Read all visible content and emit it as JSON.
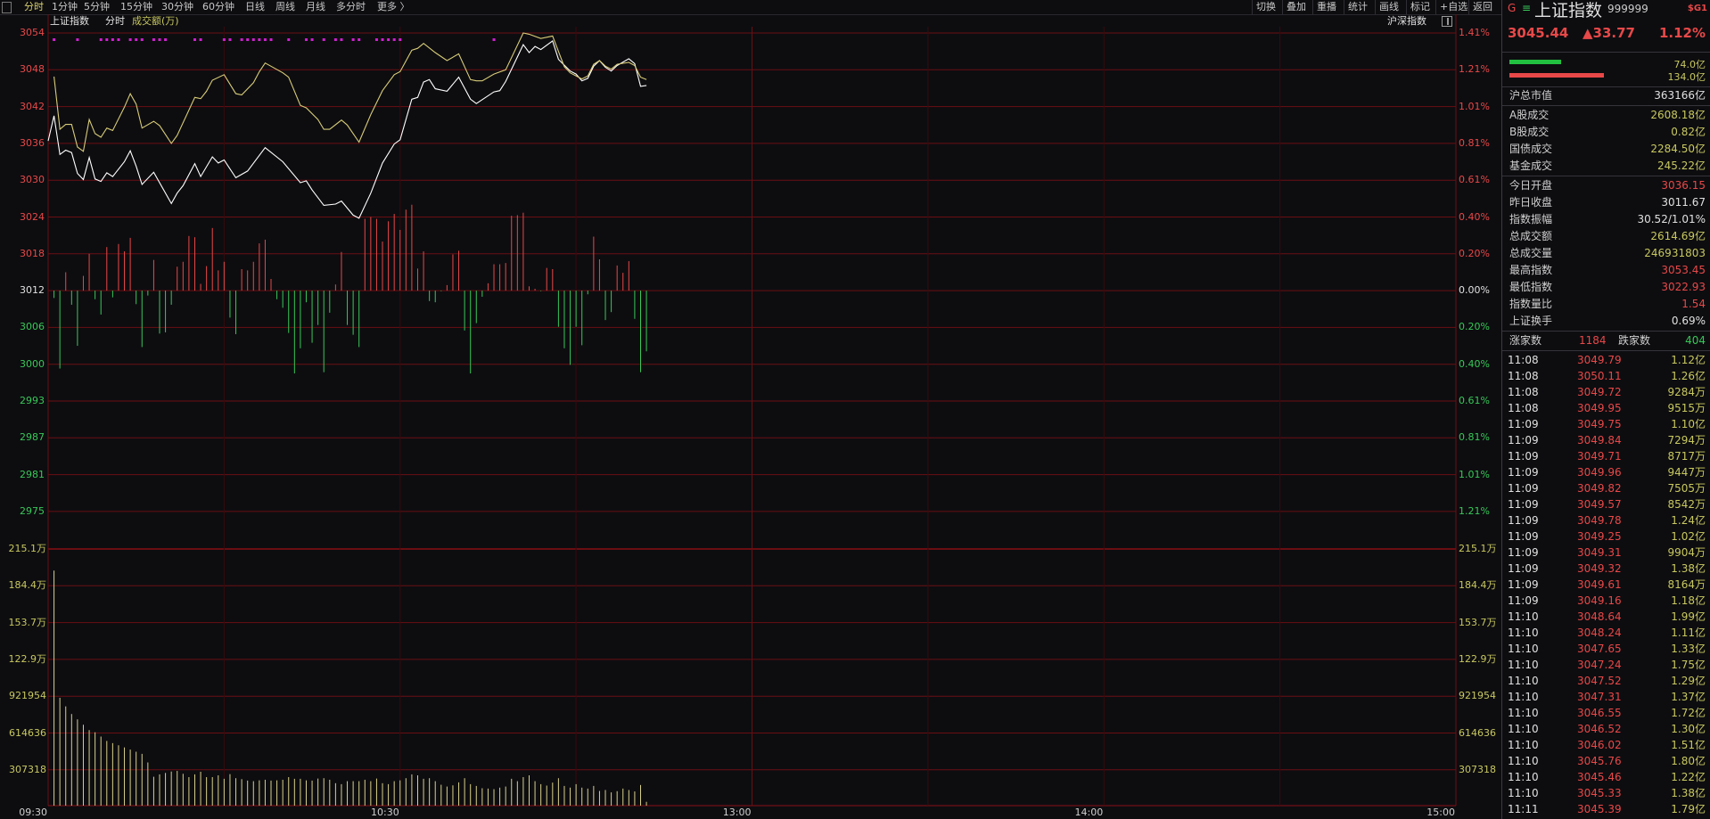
{
  "toolbar": {
    "tabs": [
      "分时",
      "1分钟",
      "5分钟",
      "15分钟",
      "30分钟",
      "60分钟",
      "日线",
      "周线",
      "月线",
      "多分时",
      "更多 〉"
    ],
    "active_tab": "分时",
    "buttons": [
      "切换",
      "叠加",
      "重播",
      "统计",
      "画线",
      "标记",
      "+自选",
      "返回"
    ]
  },
  "chart_header": {
    "index_name": "上证指数",
    "mode": "分时",
    "indicator": "成交额(万)",
    "overlay_label": "沪深指数"
  },
  "colors": {
    "background": "#0d0d10",
    "grid": "#6a0e12",
    "up": "#e84848",
    "down": "#38c858",
    "index_line": "#ffffff",
    "avg_line": "#d8cc78",
    "volume": "#d8d08a",
    "signal": "#d020d0"
  },
  "chart_data": {
    "type": "line",
    "title": "",
    "x_ticks": [
      "09:30",
      "10:30",
      "13:00",
      "14:00",
      "15:00"
    ],
    "price_axis": {
      "ticks": [
        "3054",
        "3048",
        "3042",
        "3036",
        "3030",
        "3024",
        "3018",
        "3012",
        "3006",
        "3000",
        "2993",
        "2987",
        "2981",
        "2975"
      ],
      "ylim": [
        2975,
        3054
      ],
      "base": 3012
    },
    "percent_axis": {
      "ticks": [
        "1.41%",
        "1.21%",
        "1.01%",
        "0.81%",
        "0.61%",
        "0.40%",
        "0.20%",
        "0.00%",
        "0.20%",
        "0.40%",
        "0.61%",
        "0.81%",
        "1.01%",
        "1.21%"
      ]
    },
    "volume_axis": {
      "ticks": [
        "215.1万",
        "184.4万",
        "153.7万",
        "122.9万",
        "921954",
        "614636",
        "307318"
      ],
      "ylim": [
        0,
        2151226
      ]
    },
    "series": [
      {
        "color": "#ffffff",
        "points": [
          [
            "09:30",
            3036.4
          ],
          [
            "09:31",
            3040.5
          ],
          [
            "09:32",
            3034.2
          ],
          [
            "09:33",
            3034.9
          ],
          [
            "09:34",
            3034.5
          ],
          [
            "09:35",
            3031.1
          ],
          [
            "09:36",
            3030.1
          ],
          [
            "09:37",
            3033.7
          ],
          [
            "09:38",
            3030.2
          ],
          [
            "09:39",
            3029.8
          ],
          [
            "09:40",
            3031.2
          ],
          [
            "09:41",
            3030.6
          ],
          [
            "09:43",
            3033.0
          ],
          [
            "09:44",
            3034.8
          ],
          [
            "09:45",
            3032.3
          ],
          [
            "09:46",
            3029.3
          ],
          [
            "09:48",
            3031.3
          ],
          [
            "09:51",
            3026.2
          ],
          [
            "09:52",
            3027.9
          ],
          [
            "09:53",
            3029.1
          ],
          [
            "09:55",
            3032.7
          ],
          [
            "09:56",
            3030.6
          ],
          [
            "09:58",
            3033.8
          ],
          [
            "09:59",
            3032.8
          ],
          [
            "10:00",
            3033.3
          ],
          [
            "10:02",
            3030.4
          ],
          [
            "10:04",
            3031.5
          ],
          [
            "10:07",
            3035.3
          ],
          [
            "10:10",
            3033.0
          ],
          [
            "10:13",
            3029.6
          ],
          [
            "10:14",
            3029.9
          ],
          [
            "10:15",
            3028.4
          ],
          [
            "10:17",
            3025.9
          ],
          [
            "10:19",
            3026.1
          ],
          [
            "10:20",
            3026.6
          ],
          [
            "10:22",
            3024.3
          ],
          [
            "10:23",
            3023.8
          ],
          [
            "10:25",
            3027.9
          ],
          [
            "10:27",
            3032.8
          ],
          [
            "10:29",
            3035.9
          ],
          [
            "10:30",
            3036.6
          ],
          [
            "10:32",
            3043.2
          ],
          [
            "10:33",
            3043.5
          ],
          [
            "10:34",
            3046.0
          ],
          [
            "10:35",
            3046.4
          ],
          [
            "10:36",
            3044.9
          ],
          [
            "10:38",
            3044.5
          ],
          [
            "10:40",
            3046.8
          ],
          [
            "10:42",
            3043.2
          ],
          [
            "10:43",
            3042.5
          ],
          [
            "10:46",
            3044.4
          ],
          [
            "10:47",
            3044.6
          ],
          [
            "10:48",
            3046.1
          ],
          [
            "10:51",
            3052.1
          ],
          [
            "10:52",
            3050.8
          ],
          [
            "10:53",
            3051.8
          ],
          [
            "10:54",
            3051.3
          ],
          [
            "10:56",
            3052.7
          ],
          [
            "10:57",
            3049.7
          ],
          [
            "10:59",
            3047.8
          ],
          [
            "11:00",
            3047.3
          ],
          [
            "11:01",
            3046.2
          ],
          [
            "11:02",
            3046.6
          ],
          [
            "11:03",
            3048.6
          ],
          [
            "11:04",
            3049.5
          ],
          [
            "11:05",
            3048.4
          ],
          [
            "11:06",
            3047.8
          ],
          [
            "11:07",
            3048.7
          ],
          [
            "11:09",
            3049.8
          ],
          [
            "11:10",
            3049.0
          ],
          [
            "11:11",
            3045.3
          ],
          [
            "11:12",
            3045.44
          ]
        ]
      },
      {
        "color": "#d8cc78",
        "points": [
          [
            "09:31",
            3046.9
          ],
          [
            "09:32",
            3038.3
          ],
          [
            "09:33",
            3039.1
          ],
          [
            "09:34",
            3039.1
          ],
          [
            "09:35",
            3035.4
          ],
          [
            "09:36",
            3034.7
          ],
          [
            "09:37",
            3039.9
          ],
          [
            "09:38",
            3037.6
          ],
          [
            "09:39",
            3037.0
          ],
          [
            "09:40",
            3038.5
          ],
          [
            "09:41",
            3038.1
          ],
          [
            "09:43",
            3041.9
          ],
          [
            "09:44",
            3044.1
          ],
          [
            "09:45",
            3042.4
          ],
          [
            "09:46",
            3038.5
          ],
          [
            "09:48",
            3039.6
          ],
          [
            "09:49",
            3038.9
          ],
          [
            "09:51",
            3036.0
          ],
          [
            "09:52",
            3037.3
          ],
          [
            "09:55",
            3043.5
          ],
          [
            "09:56",
            3043.3
          ],
          [
            "09:57",
            3044.5
          ],
          [
            "09:58",
            3046.3
          ],
          [
            "10:00",
            3047.2
          ],
          [
            "10:02",
            3044.1
          ],
          [
            "10:03",
            3043.9
          ],
          [
            "10:05",
            3045.9
          ],
          [
            "10:06",
            3047.7
          ],
          [
            "10:07",
            3049.1
          ],
          [
            "10:10",
            3047.5
          ],
          [
            "10:11",
            3046.8
          ],
          [
            "10:13",
            3042.2
          ],
          [
            "10:14",
            3041.8
          ],
          [
            "10:16",
            3039.9
          ],
          [
            "10:17",
            3038.3
          ],
          [
            "10:18",
            3038.3
          ],
          [
            "10:20",
            3039.8
          ],
          [
            "10:21",
            3039.0
          ],
          [
            "10:23",
            3036.2
          ],
          [
            "10:25",
            3040.7
          ],
          [
            "10:27",
            3044.6
          ],
          [
            "10:29",
            3047.2
          ],
          [
            "10:30",
            3047.7
          ],
          [
            "10:32",
            3051.2
          ],
          [
            "10:33",
            3051.5
          ],
          [
            "10:34",
            3052.3
          ],
          [
            "10:36",
            3050.8
          ],
          [
            "10:38",
            3049.5
          ],
          [
            "10:40",
            3050.6
          ],
          [
            "10:42",
            3046.4
          ],
          [
            "10:43",
            3046.2
          ],
          [
            "10:44",
            3046.2
          ],
          [
            "10:46",
            3047.3
          ],
          [
            "10:48",
            3048.0
          ],
          [
            "10:51",
            3054.0
          ],
          [
            "10:52",
            3053.8
          ],
          [
            "10:54",
            3053.1
          ],
          [
            "10:56",
            3053.5
          ],
          [
            "10:58",
            3048.5
          ],
          [
            "10:59",
            3047.5
          ],
          [
            "11:01",
            3046.5
          ],
          [
            "11:02",
            3047.0
          ],
          [
            "11:03",
            3048.9
          ],
          [
            "11:04",
            3049.5
          ],
          [
            "11:05",
            3048.6
          ],
          [
            "11:06",
            3048.1
          ],
          [
            "11:07",
            3048.9
          ],
          [
            "11:09",
            3049.2
          ],
          [
            "11:10",
            3048.7
          ],
          [
            "11:11",
            3046.8
          ],
          [
            "11:12",
            3046.4
          ]
        ]
      }
    ],
    "breadth_bars": [
      -1.2,
      -12.7,
      3.0,
      -2.3,
      -9.0,
      2.4,
      6.0,
      -1.4,
      -3.9,
      7.1,
      -1.1,
      7.6,
      6.4,
      8.6,
      -2.2,
      -9.2,
      -0.8,
      5.0,
      -7.0,
      -6.8,
      -2.3,
      3.9,
      4.7,
      8.9,
      8.7,
      1.1,
      4.0,
      10.2,
      3.3,
      4.7,
      -4.4,
      -7.1,
      3.5,
      3.3,
      4.7,
      7.7,
      8.3,
      1.9,
      -1.4,
      -2.8,
      -6.9,
      -13.5,
      -9.4,
      -1.9,
      -8.5,
      -5.6,
      -13.3,
      -3.6,
      1.0,
      6.3,
      -5.6,
      -7.2,
      -9.2,
      11.7,
      12.0,
      11.7,
      8.0,
      11.3,
      12.5,
      9.9,
      13.2,
      14.0,
      3.6,
      6.4,
      -1.7,
      -1.9,
      -0.1,
      0.9,
      5.9,
      6.5,
      -6.5,
      -13.5,
      -5.3,
      -1.0,
      1.2,
      4.3,
      4.3,
      4.5,
      12.2,
      12.3,
      12.7,
      0.7,
      0.3,
      -0.1,
      3.7,
      3.5,
      -5.9,
      -9.4,
      -12.1,
      -5.9,
      -8.9,
      -0.6,
      8.8,
      5.1,
      -4.8,
      -3.5,
      4.1,
      2.9,
      4.8,
      -4.6,
      -13.3,
      -9.9
    ],
    "volume": [
      1970000,
      904000,
      832000,
      768000,
      723000,
      678000,
      633000,
      615000,
      579000,
      542000,
      524000,
      506000,
      488000,
      470000,
      452000,
      434000,
      362000,
      242000,
      262000,
      274000,
      286000,
      291000,
      267000,
      239000,
      262000,
      284000,
      239000,
      239000,
      254000,
      225000,
      264000,
      230000,
      222000,
      210000,
      205000,
      212000,
      217000,
      210000,
      212000,
      217000,
      239000,
      225000,
      225000,
      212000,
      210000,
      227000,
      230000,
      217000,
      188000,
      180000,
      205000,
      205000,
      205000,
      217000,
      205000,
      227000,
      188000,
      180000,
      205000,
      212000,
      230000,
      262000,
      254000,
      225000,
      230000,
      205000,
      175000,
      160000,
      170000,
      195000,
      230000,
      180000,
      165000,
      146000,
      143000,
      138000,
      151000,
      160000,
      225000,
      205000,
      239000,
      254000,
      205000,
      180000,
      168000,
      193000,
      230000,
      165000,
      151000,
      180000,
      151000,
      143000,
      165000,
      123000,
      131000,
      111000,
      121000,
      143000,
      131000,
      119000,
      173000,
      32000
    ],
    "signal_times": [
      "09:31",
      "09:35",
      "09:39",
      "09:40",
      "09:41",
      "09:42",
      "09:44",
      "09:45",
      "09:46",
      "09:48",
      "09:49",
      "09:50",
      "09:55",
      "09:56",
      "10:00",
      "10:01",
      "10:03",
      "10:04",
      "10:05",
      "10:06",
      "10:07",
      "10:08",
      "10:11",
      "10:14",
      "10:15",
      "10:17",
      "10:19",
      "10:20",
      "10:22",
      "10:23",
      "10:26",
      "10:27",
      "10:28",
      "10:29",
      "10:30",
      "10:46"
    ],
    "grid": true
  },
  "quote": {
    "flag": "G",
    "menu_glyph": "≡",
    "name": "上证指数",
    "code": "999999",
    "tag": "$G1",
    "price": "3045.44",
    "change": "▲33.77",
    "change_pct": "1.12%",
    "buy_amount": "74.0亿",
    "sell_amount": "134.0亿",
    "buy_bar_fraction": 0.36,
    "sell_bar_fraction": 0.66
  },
  "stats_top": [
    {
      "label": "沪总市值",
      "value": "363166亿",
      "color": "white"
    }
  ],
  "stats_trade": [
    {
      "label": "A股成交",
      "value": "2608.18亿",
      "color": "yellow"
    },
    {
      "label": "B股成交",
      "value": "0.82亿",
      "color": "yellow"
    },
    {
      "label": "国债成交",
      "value": "2284.50亿",
      "color": "yellow"
    },
    {
      "label": "基金成交",
      "value": "245.22亿",
      "color": "yellow"
    }
  ],
  "stats_index": [
    {
      "label": "今日开盘",
      "value": "3036.15",
      "color": "red"
    },
    {
      "label": "昨日收盘",
      "value": "3011.67",
      "color": "white"
    },
    {
      "label": "指数振幅",
      "value": "30.52/1.01%",
      "color": "white"
    },
    {
      "label": "总成交额",
      "value": "2614.69亿",
      "color": "yellow"
    },
    {
      "label": "总成交量",
      "value": "246931803",
      "color": "yellow"
    },
    {
      "label": "最高指数",
      "value": "3053.45",
      "color": "red"
    },
    {
      "label": "最低指数",
      "value": "3022.93",
      "color": "red"
    },
    {
      "label": "指数量比",
      "value": "1.54",
      "color": "red"
    },
    {
      "label": "上证换手",
      "value": "0.69%",
      "color": "white"
    }
  ],
  "breadth": {
    "up_label": "涨家数",
    "up_count": "1184",
    "down_label": "跌家数",
    "down_count": "404"
  },
  "ticks": [
    [
      "11:08",
      "3049.79",
      "1.12亿"
    ],
    [
      "11:08",
      "3050.11",
      "1.26亿"
    ],
    [
      "11:08",
      "3049.72",
      "9284万"
    ],
    [
      "11:08",
      "3049.95",
      "9515万"
    ],
    [
      "11:09",
      "3049.75",
      "1.10亿"
    ],
    [
      "11:09",
      "3049.84",
      "7294万"
    ],
    [
      "11:09",
      "3049.71",
      "8717万"
    ],
    [
      "11:09",
      "3049.96",
      "9447万"
    ],
    [
      "11:09",
      "3049.82",
      "7505万"
    ],
    [
      "11:09",
      "3049.57",
      "8542万"
    ],
    [
      "11:09",
      "3049.78",
      "1.24亿"
    ],
    [
      "11:09",
      "3049.25",
      "1.02亿"
    ],
    [
      "11:09",
      "3049.31",
      "9904万"
    ],
    [
      "11:09",
      "3049.32",
      "1.38亿"
    ],
    [
      "11:09",
      "3049.61",
      "8164万"
    ],
    [
      "11:09",
      "3049.16",
      "1.18亿"
    ],
    [
      "11:10",
      "3048.64",
      "1.99亿"
    ],
    [
      "11:10",
      "3048.24",
      "1.11亿"
    ],
    [
      "11:10",
      "3047.65",
      "1.33亿"
    ],
    [
      "11:10",
      "3047.24",
      "1.75亿"
    ],
    [
      "11:10",
      "3047.52",
      "1.29亿"
    ],
    [
      "11:10",
      "3047.31",
      "1.37亿"
    ],
    [
      "11:10",
      "3046.55",
      "1.72亿"
    ],
    [
      "11:10",
      "3046.52",
      "1.30亿"
    ],
    [
      "11:10",
      "3046.02",
      "1.51亿"
    ],
    [
      "11:10",
      "3045.76",
      "1.80亿"
    ],
    [
      "11:10",
      "3045.46",
      "1.22亿"
    ],
    [
      "11:10",
      "3045.33",
      "1.38亿"
    ],
    [
      "11:11",
      "3045.39",
      "1.79亿"
    ]
  ]
}
